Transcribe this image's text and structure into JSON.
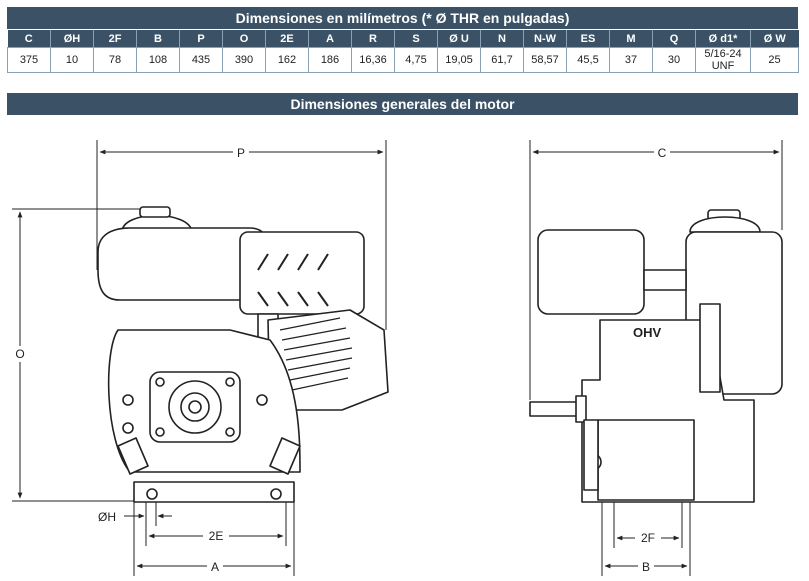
{
  "table_title": "Dimensiones en milímetros (* Ø THR en pulgadas)",
  "headers": [
    "C",
    "ØH",
    "2F",
    "B",
    "P",
    "O",
    "2E",
    "A",
    "R",
    "S",
    "Ø U",
    "N",
    "N-W",
    "ES",
    "M",
    "Q",
    "Ø d1*",
    "Ø W"
  ],
  "values": [
    "375",
    "10",
    "78",
    "108",
    "435",
    "390",
    "162",
    "186",
    "16,36",
    "4,75",
    "19,05",
    "61,7",
    "58,57",
    "45,5",
    "37",
    "30",
    "5/16-24 UNF",
    "25"
  ],
  "section_title": "Dimensiones generales del motor",
  "diagram_labels": {
    "P": "P",
    "O": "O",
    "OH": "ØH",
    "E2": "2E",
    "A": "A",
    "C": "C",
    "F2": "2F",
    "B": "B",
    "ohv": "OHV"
  }
}
